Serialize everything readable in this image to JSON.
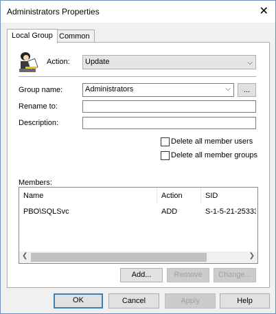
{
  "window": {
    "title": "Administrators Properties"
  },
  "tabs": [
    {
      "label": "Local Group"
    },
    {
      "label": "Common"
    }
  ],
  "form": {
    "action_label": "Action:",
    "action_value": "Update",
    "group_name_label": "Group name:",
    "group_name_value": "Administrators",
    "browse_label": "...",
    "rename_label": "Rename to:",
    "rename_value": "",
    "description_label": "Description:",
    "description_value": "",
    "delete_users_label": "Delete all member users",
    "delete_groups_label": "Delete all member groups",
    "delete_users_checked": false,
    "delete_groups_checked": false
  },
  "members": {
    "label": "Members:",
    "columns": [
      "Name",
      "Action",
      "SID"
    ],
    "rows": [
      {
        "name": "PBO\\SQLSvc",
        "action": "ADD",
        "sid": "S-1-5-21-25333"
      }
    ]
  },
  "member_buttons": {
    "add": "Add...",
    "remove": "Remove",
    "change": "Change..."
  },
  "dialog_buttons": {
    "ok": "OK",
    "cancel": "Cancel",
    "apply": "Apply",
    "help": "Help"
  },
  "icons": {
    "group_icon": "user-group-icon",
    "close": "close-icon"
  }
}
